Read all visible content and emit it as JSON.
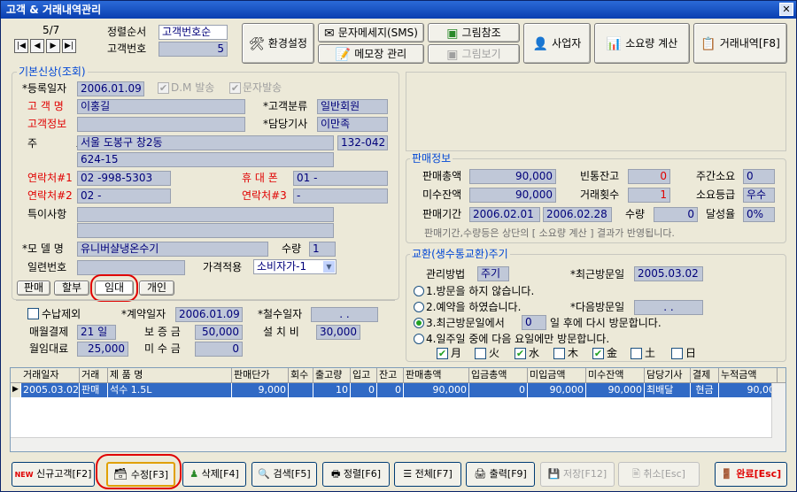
{
  "window": {
    "title": "고객 & 거래내역관리",
    "close": "✕"
  },
  "nav": {
    "record": "5/7",
    "sort_label": "정렬순서",
    "sort_value": "고객번호순",
    "custno_label": "고객번호",
    "custno_value": "5"
  },
  "toolbar": {
    "env": "환경설정",
    "sms": "문자메세지(SMS)",
    "memo": "메모장 관리",
    "pic_ref": "그림참조",
    "pic_view": "그림보기",
    "business": "사업자",
    "consume_calc": "소요량 계산",
    "trade_detail": "거래내역[F8]"
  },
  "basic": {
    "group_title": "기본신상(조회)",
    "reg_date_label": "*등록일자",
    "reg_date": "2006.01.09",
    "dm_label": "D.M 발송",
    "sms_label": "문자발송",
    "name_label": "고 객 명",
    "name": "이홍길",
    "class_label": "*고객분류",
    "class_value": "일반회원",
    "info_label": "고객정보",
    "staff_label": "*담당기사",
    "staff": "이만족",
    "addr_label": "주 소",
    "addr1": "서울 도봉구 창2동",
    "zip": "132-042",
    "addr2": "624-15",
    "tel1_label": "연락처#1",
    "tel1": "02 -998-5303",
    "mobile_label": "휴 대 폰",
    "mobile": "01 -",
    "tel2_label": "연락처#2",
    "tel2": "02 -",
    "tel3_label": "연락처#3",
    "tel3": "-",
    "note_label": "특이사항",
    "model_label": "*모 델 명",
    "model": "유니버샬냉온수기",
    "qty_label": "수량",
    "qty": "1",
    "serial_label": "일련번호",
    "price_label": "가격적용",
    "price_value": "소비자가-1"
  },
  "tabs": [
    "판매",
    "할부",
    "임대",
    "개인"
  ],
  "rental": {
    "collect_label": "수납제외",
    "contract_label": "*계약일자",
    "contract_date": "2006.01.09",
    "withdraw_label": "*철수일자",
    "withdraw_date": ". .",
    "monthly_label": "매월결제",
    "monthly_day": "21 일",
    "deposit_label": "보 증 금",
    "deposit": "50,000",
    "install_label": "설 치 비",
    "install": "30,000",
    "fee_label": "월임대료",
    "fee": "25,000",
    "unpaid_label": "미 수 금",
    "unpaid": "0"
  },
  "sales": {
    "group_title": "판매정보",
    "total_label": "판매총액",
    "total": "90,000",
    "empty_label": "빈통잔고",
    "empty": "0",
    "weekly_label": "주간소요",
    "weekly": "0",
    "unpaid_label": "미수잔액",
    "unpaid": "90,000",
    "count_label": "거래횟수",
    "count": "1",
    "grade_label": "소요등급",
    "grade": "우수",
    "period_label": "판매기간",
    "period_from": "2006.02.01",
    "period_to": "2006.02.28",
    "qty_label": "수량",
    "qty": "0",
    "rate_label": "달성율",
    "rate": "0%",
    "note": "판매기간,수량등은 상단의 [ 소요량 계산 ] 결과가 반영됩니다."
  },
  "exchange": {
    "group_title": "교환(생수통교환)주기",
    "method_label": "관리방법",
    "method": "주기",
    "last_visit_label": "*최근방문일",
    "last_visit": "2005.03.02",
    "opt1": "1.방문을 하지 않습니다.",
    "opt2": "2.예약을 하였습니다.",
    "next_visit_label": "*다음방문일",
    "next_visit": ". .",
    "opt3_pre": "3.최근방문일에서",
    "opt3_days": "0",
    "opt3_post": "일 후에 다시 방문합니다.",
    "opt4": "4.일주일 중에 다음 요일에만 방문합니다.",
    "days": [
      {
        "d": "月",
        "checked": true
      },
      {
        "d": "火",
        "checked": false
      },
      {
        "d": "水",
        "checked": true
      },
      {
        "d": "木",
        "checked": false
      },
      {
        "d": "金",
        "checked": true
      },
      {
        "d": "土",
        "checked": false
      },
      {
        "d": "日",
        "checked": false
      }
    ]
  },
  "table": {
    "headers": [
      "거래일자",
      "거래",
      "제 품 명",
      "판매단가",
      "회수",
      "출고량",
      "입고",
      "잔고",
      "판매총액",
      "입금총액",
      "미입금액",
      "미수잔액",
      "담당기사",
      "결제",
      "누적금액"
    ],
    "rows": [
      [
        "2005.03.02",
        "판매",
        "석수 1.5L",
        "9,000",
        "",
        "10",
        "0",
        "0",
        "90,000",
        "0",
        "90,000",
        "90,000",
        "최배달",
        "현금",
        "90,00"
      ]
    ]
  },
  "bottom": {
    "new": "신규고객[F2]",
    "new_badge": "NEW",
    "edit": "수정[F3]",
    "delete": "삭제[F4]",
    "search": "검색[F5]",
    "sort": "정렬[F6]",
    "all": "전체[F7]",
    "print": "출력[F9]",
    "save": "저장[F12]",
    "cancel": "취소[Esc]",
    "done": "완료[Esc]"
  },
  "accent": {
    "title": "#0a3fb0",
    "field": "#c0c8d8",
    "value": "#00007a",
    "selected": "#316ac5",
    "circle": "#e00000"
  }
}
